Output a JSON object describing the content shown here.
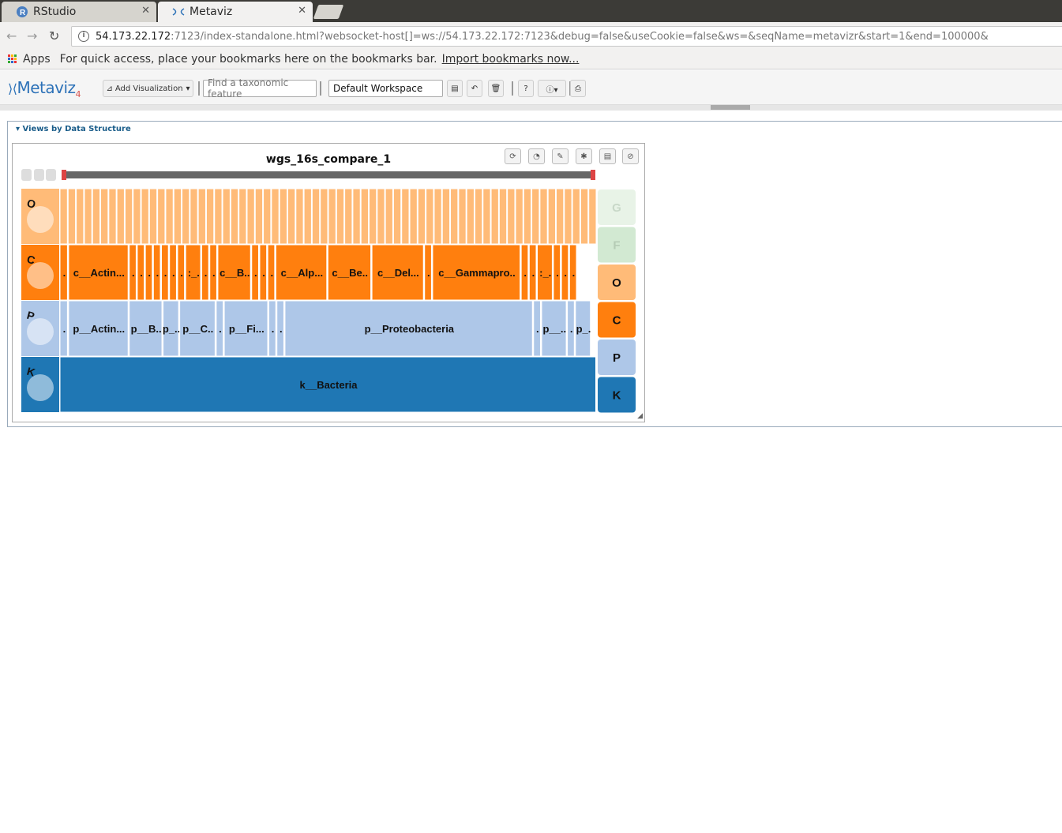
{
  "browser": {
    "tabs": [
      {
        "label": "RStudio",
        "active": false
      },
      {
        "label": "Metaviz",
        "active": true
      }
    ],
    "url_host": "54.173.22.172",
    "url_rest": ":7123/index-standalone.html?websocket-host[]=ws://54.173.22.172:7123&debug=false&useCookie=false&ws=&seqName=metavizr&start=1&end=100000&",
    "bookmarks": {
      "apps_label": "Apps",
      "hint": "For quick access, place your bookmarks here on the bookmarks bar.",
      "import_link": "Import bookmarks now..."
    }
  },
  "app": {
    "logo_text": "Metaviz",
    "logo_version": "4",
    "add_viz_label": "Add Visualization",
    "search_placeholder": "Find a taxonomic feature",
    "workspace_value": "Default Workspace"
  },
  "panel": {
    "title": "Views by Data Structure"
  },
  "visualization": {
    "title": "wgs_16s_compare_1",
    "level_buttons": [
      {
        "label": "G",
        "color": "#e8f3e7",
        "text": "#c8d8c8"
      },
      {
        "label": "F",
        "color": "#d2e9d2",
        "text": "#b5ccb5"
      },
      {
        "label": "O",
        "color": "#ffbb78",
        "text": "#111"
      },
      {
        "label": "C",
        "color": "#ff7f0e",
        "text": "#111"
      },
      {
        "label": "P",
        "color": "#aec7e8",
        "text": "#111"
      },
      {
        "label": "K",
        "color": "#1f77b4",
        "text": "#111"
      }
    ],
    "row_labels": [
      "O",
      "C",
      "P",
      "K"
    ],
    "colors": {
      "order": "#ffbb78",
      "class": "#ff7f0e",
      "phylum": "#aec7e8",
      "kingdom": "#1f77b4"
    },
    "rows": {
      "class_labels": [
        {
          "w": 0.016,
          "t": "."
        },
        {
          "w": 0.113,
          "t": "c__Actin..."
        },
        {
          "w": 0.015,
          "t": "."
        },
        {
          "w": 0.015,
          "t": "."
        },
        {
          "w": 0.015,
          "t": "."
        },
        {
          "w": 0.015,
          "t": "."
        },
        {
          "w": 0.015,
          "t": "."
        },
        {
          "w": 0.015,
          "t": "."
        },
        {
          "w": 0.015,
          "t": "."
        },
        {
          "w": 0.03,
          "t": ":_."
        },
        {
          "w": 0.015,
          "t": "."
        },
        {
          "w": 0.015,
          "t": "."
        },
        {
          "w": 0.063,
          "t": "c__B.."
        },
        {
          "w": 0.015,
          "t": "."
        },
        {
          "w": 0.015,
          "t": "."
        },
        {
          "w": 0.015,
          "t": "."
        },
        {
          "w": 0.097,
          "t": "c__Alp..."
        },
        {
          "w": 0.082,
          "t": "c__Be.."
        },
        {
          "w": 0.098,
          "t": "c__Del..."
        },
        {
          "w": 0.015,
          "t": "."
        },
        {
          "w": 0.165,
          "t": "c__Gammapro.."
        },
        {
          "w": 0.015,
          "t": "."
        },
        {
          "w": 0.015,
          "t": "."
        },
        {
          "w": 0.03,
          "t": ":_."
        },
        {
          "w": 0.015,
          "t": "."
        },
        {
          "w": 0.015,
          "t": "."
        },
        {
          "w": 0.015,
          "t": "."
        }
      ],
      "phylum_labels": [
        {
          "w": 0.016,
          "t": "."
        },
        {
          "w": 0.113,
          "t": "p__Actin..."
        },
        {
          "w": 0.063,
          "t": "p__B.."
        },
        {
          "w": 0.031,
          "t": "p_.."
        },
        {
          "w": 0.068,
          "t": "p__C.."
        },
        {
          "w": 0.015,
          "t": "."
        },
        {
          "w": 0.083,
          "t": "p__Fi..."
        },
        {
          "w": 0.015,
          "t": "."
        },
        {
          "w": 0.015,
          "t": "."
        },
        {
          "w": 0.463,
          "t": "p__Proteobacteria"
        },
        {
          "w": 0.015,
          "t": "."
        },
        {
          "w": 0.048,
          "t": "p__.."
        },
        {
          "w": 0.015,
          "t": "."
        },
        {
          "w": 0.03,
          "t": "p_."
        }
      ],
      "kingdom_labels": [
        {
          "w": 1.0,
          "t": "k__Bacteria"
        }
      ],
      "order_count": 66
    }
  }
}
